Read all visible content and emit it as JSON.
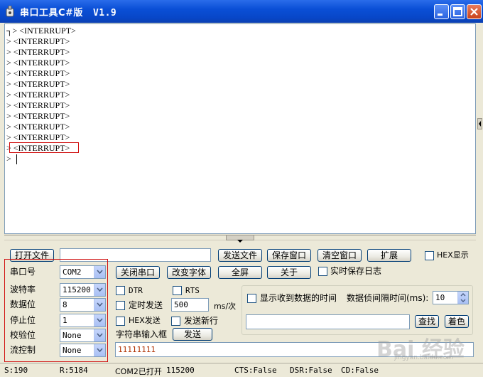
{
  "window": {
    "title": "串口工具C#版",
    "version": "V1.9"
  },
  "console": {
    "lines": [
      "┐> <INTERRUPT>",
      "> <INTERRUPT>",
      "> <INTERRUPT>",
      "> <INTERRUPT>",
      "> <INTERRUPT>",
      "> <INTERRUPT>",
      "> <INTERRUPT>",
      "> <INTERRUPT>",
      "> <INTERRUPT>",
      "> <INTERRUPT>",
      "> <INTERRUPT>",
      "> <INTERRUPT>",
      ">"
    ]
  },
  "toolbar": {
    "open_file": "打开文件",
    "send_file": "发送文件",
    "save_window": "保存窗口",
    "clear_window": "清空窗口",
    "extend": "扩展",
    "hex_display": "HEX显示",
    "close_port": "关闭串口",
    "change_font": "改变字体",
    "fullscreen": "全屏",
    "about": "关于",
    "realtime_log": "实时保存日志"
  },
  "port": {
    "port_label": "串口号",
    "port_value": "COM2",
    "baud_label": "波特率",
    "baud_value": "115200",
    "databits_label": "数据位",
    "databits_value": "8",
    "stopbits_label": "停止位",
    "stopbits_value": "1",
    "parity_label": "校验位",
    "parity_value": "None",
    "flow_label": "流控制",
    "flow_value": "None"
  },
  "send": {
    "dtr": "DTR",
    "rts": "RTS",
    "timed_send": "定时发送",
    "interval_value": "500",
    "interval_unit": "ms/次",
    "hex_send": "HEX发送",
    "send_newline": "发送新行",
    "string_input_label": "字符串输入框",
    "send_button": "发送",
    "input_value": "11111111"
  },
  "receive": {
    "show_time": "显示收到数据的时间",
    "frame_interval_label": "数据侦间隔时间(ms):",
    "frame_interval_value": "10",
    "find": "查找",
    "color": "着色"
  },
  "status": {
    "sent": "S:190",
    "received": "R:5184",
    "port_state": "COM2已打开",
    "baud": "115200",
    "cts": "CTS:False",
    "dsr": "DSR:False",
    "cd": "CD:False"
  },
  "watermark": {
    "text": "Bai 经验",
    "sub": "jingyan.baidu.com"
  },
  "colors": {
    "titlebar": "#0a4fd6",
    "highlight": "#d01010",
    "input_text": "#b03000"
  }
}
